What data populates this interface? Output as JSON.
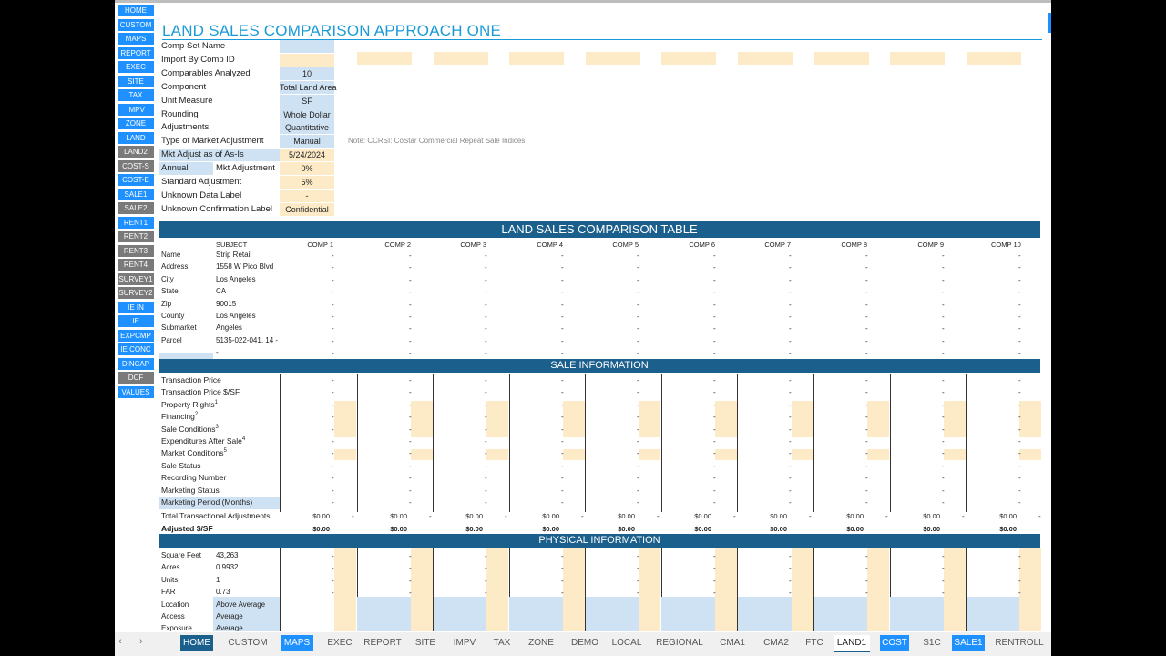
{
  "sidebar": [
    "HOME",
    "CUSTOM",
    "MAPS",
    "REPORT",
    "EXEC",
    "SITE",
    "TAX",
    "IMPV",
    "ZONE",
    "LAND",
    "LAND2",
    "COST-S",
    "COST-E",
    "SALE1",
    "SALE2",
    "RENT1",
    "RENT2",
    "RENT3",
    "RENT4",
    "SURVEY1",
    "SURVEY2",
    "IE IN",
    "IE",
    "EXPCMP",
    "IE CONC",
    "DINCAP",
    "DCF",
    "VALUES"
  ],
  "title": "LAND SALES COMPARISON APPROACH ONE",
  "settings": [
    {
      "label": "Comp Set Name",
      "value": ""
    },
    {
      "label": "Import By Comp ID",
      "value": ""
    },
    {
      "label": "Comparables Analyzed",
      "value": "10"
    },
    {
      "label": "Component",
      "value": "Total Land Area"
    },
    {
      "label": "Unit Measure",
      "value": "SF"
    },
    {
      "label": "Rounding",
      "value": "Whole Dollar"
    },
    {
      "label": "Adjustments",
      "value": "Quantitative"
    },
    {
      "label": "Type of Market Adjustment",
      "value": "Manual"
    },
    {
      "label": "Mkt Adjust as of As-Is",
      "value": "5/24/2024"
    },
    {
      "label": "Annual",
      "label2": "Mkt Adjustment",
      "value": "0%"
    },
    {
      "label": "Standard Adjustment",
      "value": "5%"
    },
    {
      "label": "Unknown Data Label",
      "value": "-"
    },
    {
      "label": "Unknown Confirmation Label",
      "value": "Confidential"
    }
  ],
  "note": "Note: CCRSI: CoStar Commercial Repeat Sale Indices",
  "comparison_table": {
    "title": "LAND SALES COMPARISON TABLE",
    "subject_header": "SUBJECT",
    "comp_headers": [
      "COMP 1",
      "COMP 2",
      "COMP 3",
      "COMP 4",
      "COMP 5",
      "COMP 6",
      "COMP 7",
      "COMP 8",
      "COMP 9",
      "COMP 10"
    ],
    "rows": [
      {
        "label": "Name",
        "subject": "Strip Retail"
      },
      {
        "label": "Address",
        "subject": "1558 W Pico Blvd"
      },
      {
        "label": "City",
        "subject": "Los Angeles"
      },
      {
        "label": "State",
        "subject": "CA"
      },
      {
        "label": "Zip",
        "subject": "90015"
      },
      {
        "label": "County",
        "subject": "Los Angeles"
      },
      {
        "label": "Submarket",
        "subject": "Angeles"
      },
      {
        "label": "Parcel",
        "subject": "5135-022-041, 14 -"
      },
      {
        "label": "",
        "subject": "-"
      }
    ]
  },
  "sale_information": {
    "title": "SALE INFORMATION",
    "rows": [
      "Transaction Price",
      "Transaction Price $/SF",
      "Property Rights",
      "Financing",
      "Sale Conditions",
      "Expenditures After Sale",
      "Market Conditions",
      "Sale Status",
      "Recording Number",
      "Marketing Status",
      "Marketing Period (Months)"
    ],
    "superscripts": [
      "",
      "",
      "1",
      "2",
      "3",
      "4",
      "5",
      "",
      "",
      "",
      ""
    ],
    "total_label": "Total Transactional Adjustments",
    "adjusted_label": "Adjusted $/SF",
    "money_value": "$0.00"
  },
  "physical_information": {
    "title": "PHYSICAL INFORMATION",
    "rows": [
      {
        "label": "Square Feet",
        "subject": "43,263"
      },
      {
        "label": "Acres",
        "subject": "0.9932"
      },
      {
        "label": "Units",
        "subject": "1"
      },
      {
        "label": "FAR",
        "subject": "0.73"
      },
      {
        "label": "Location",
        "subject": "Above Average"
      },
      {
        "label": "Access",
        "subject": "Average"
      },
      {
        "label": "Exposure",
        "subject": "Average"
      }
    ]
  },
  "dash": "-",
  "tabs": [
    "HOME",
    "CUSTOM",
    "MAPS",
    "EXEC",
    "REPORT",
    "SITE",
    "IMPV",
    "TAX",
    "ZONE",
    "DEMO",
    "LOCAL",
    "REGIONAL",
    "CMA1",
    "CMA2",
    "FTC",
    "LAND1",
    "COST",
    "S1C",
    "SALE1",
    "RENTROLL"
  ],
  "active_tab": "LAND1"
}
